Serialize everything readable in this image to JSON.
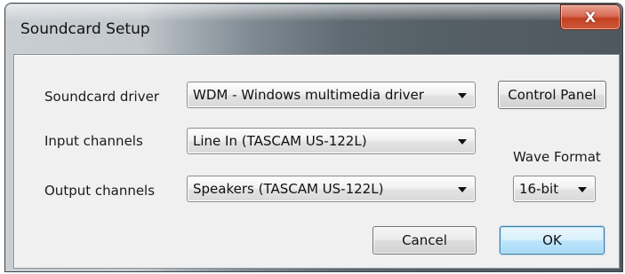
{
  "window": {
    "title": "Soundcard Setup",
    "close_glyph": "X"
  },
  "form": {
    "driver_label": "Soundcard driver",
    "driver_value": "WDM - Windows multimedia driver",
    "control_panel_label": "Control Panel",
    "input_label": "Input channels",
    "input_value": "Line In (TASCAM US-122L)",
    "output_label": "Output channels",
    "output_value": "Speakers (TASCAM US-122L)",
    "wave_format_label": "Wave Format",
    "wave_format_value": "16-bit"
  },
  "buttons": {
    "cancel_label": "Cancel",
    "ok_label": "OK"
  },
  "colors": {
    "close_button": "#c2401f",
    "default_button_border": "#3c7fb1"
  }
}
